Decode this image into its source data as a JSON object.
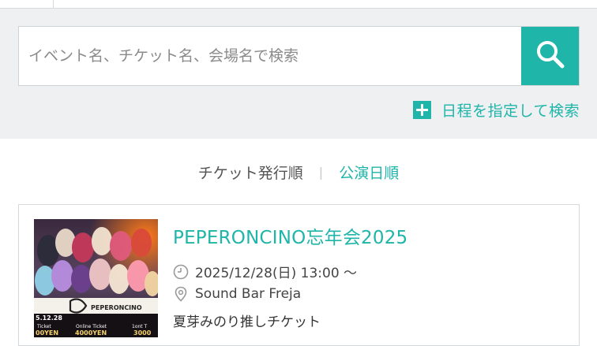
{
  "search": {
    "placeholder": "イベント名、チケット名、会場名で検索",
    "value": ""
  },
  "date_search": {
    "label": "日程を指定して検索"
  },
  "sort": {
    "options": [
      {
        "label": "チケット発行順",
        "active": false
      },
      {
        "label": "公演日順",
        "active": true
      }
    ],
    "separator": "|"
  },
  "event": {
    "title": "PEPERONCINO忘年会2025",
    "datetime": "2025/12/28(日) 13:00 〜",
    "venue": "Sound Bar Freja",
    "ticket_name": "夏芽みのり推しチケット",
    "poster": {
      "logo_text": "PEPERONCINO",
      "date_fragment": "5.12.28",
      "ticket_labels": [
        "Ticket",
        "Online Ticket",
        "1ont T"
      ],
      "prices": [
        "00YEN",
        "4000YEN",
        "3000"
      ]
    }
  },
  "colors": {
    "accent": "#1fb5a9",
    "background_top": "#eef0f2",
    "border": "#d6d9dc"
  },
  "icons": {
    "search_button": "search-icon",
    "date_search": "plus-icon",
    "datetime": "clock-icon",
    "venue": "map-pin-icon"
  }
}
